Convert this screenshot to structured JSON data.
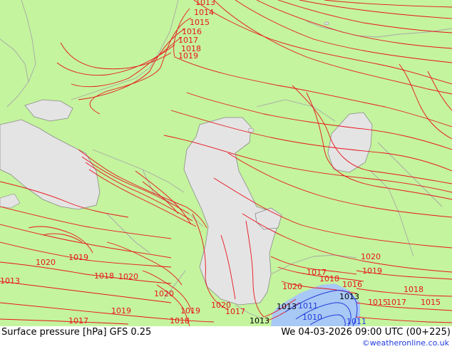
{
  "footer": {
    "title": "Surface pressure [hPa] GFS 0.25",
    "datetime": "We 04-03-2026 09:00 UTC (00+225)",
    "credit": "©weatheronline.co.uk"
  },
  "colors": {
    "land": "#c4f49e",
    "water": "#e4e4e4",
    "isobar": "#e8141b",
    "isobar_low": "#1f3bdc",
    "border": "#a8a8a8"
  },
  "isobar_labels": [
    {
      "text": "1013",
      "kind": "high"
    },
    {
      "text": "1014",
      "kind": "high"
    },
    {
      "text": "1015",
      "kind": "high"
    },
    {
      "text": "1016",
      "kind": "high"
    },
    {
      "text": "1017",
      "kind": "high"
    },
    {
      "text": "1018",
      "kind": "high"
    },
    {
      "text": "1019",
      "kind": "high"
    },
    {
      "text": "1020",
      "kind": "high"
    },
    {
      "text": "1019",
      "kind": "high"
    },
    {
      "text": "1013",
      "kind": "high"
    },
    {
      "text": "1018",
      "kind": "high"
    },
    {
      "text": "1020",
      "kind": "high"
    },
    {
      "text": "1020",
      "kind": "high"
    },
    {
      "text": "1017",
      "kind": "high"
    },
    {
      "text": "1019",
      "kind": "high"
    },
    {
      "text": "1019",
      "kind": "high"
    },
    {
      "text": "1018",
      "kind": "high"
    },
    {
      "text": "1020",
      "kind": "high"
    },
    {
      "text": "1017",
      "kind": "high"
    },
    {
      "text": "1013",
      "kind": "dark"
    },
    {
      "text": "1020",
      "kind": "high"
    },
    {
      "text": "1017",
      "kind": "high"
    },
    {
      "text": "1018",
      "kind": "high"
    },
    {
      "text": "1016",
      "kind": "high"
    },
    {
      "text": "1013",
      "kind": "dark"
    },
    {
      "text": "1019",
      "kind": "high"
    },
    {
      "text": "1020",
      "kind": "high"
    },
    {
      "text": "1018",
      "kind": "high"
    },
    {
      "text": "1015",
      "kind": "high"
    },
    {
      "text": "1017",
      "kind": "high"
    },
    {
      "text": "1015",
      "kind": "high"
    },
    {
      "text": "1011",
      "kind": "low"
    },
    {
      "text": "1010",
      "kind": "low"
    },
    {
      "text": "1011",
      "kind": "low"
    },
    {
      "text": "1013",
      "kind": "dark"
    }
  ]
}
